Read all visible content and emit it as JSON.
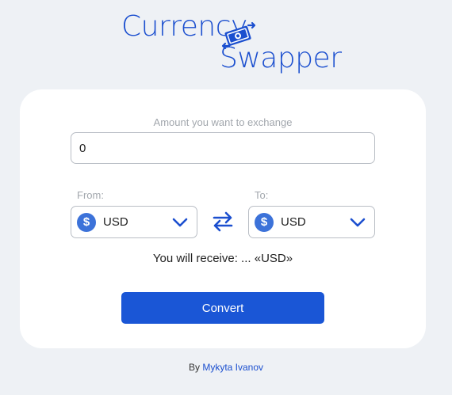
{
  "logo": {
    "line1": "Currency",
    "line2": "Swapper"
  },
  "form": {
    "amount_label": "Amount you want to exchange",
    "amount_value": "0",
    "from_label": "From:",
    "to_label": "To:",
    "from_currency": {
      "symbol": "$",
      "code": "USD"
    },
    "to_currency": {
      "symbol": "$",
      "code": "USD"
    },
    "receive_text": "You will receive: ... «USD»",
    "convert_label": "Convert"
  },
  "footer": {
    "prefix": "By",
    "author": "Mykyta Ivanov"
  },
  "colors": {
    "brand": "#1b4fcf",
    "button": "#1a56d6",
    "coin": "#3c72d9",
    "page_background": "#eef1f5",
    "card_background": "#ffffff"
  },
  "icons": {
    "logo": "money-swap-icon",
    "currency": "dollar-coin-icon",
    "dropdown": "chevron-down-icon",
    "swap": "swap-arrows-icon"
  }
}
